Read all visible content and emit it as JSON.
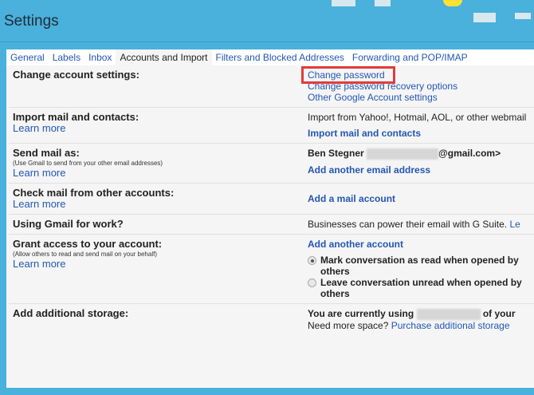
{
  "header": {
    "title": "Settings"
  },
  "tabs": [
    {
      "label": "General"
    },
    {
      "label": "Labels"
    },
    {
      "label": "Inbox"
    },
    {
      "label": "Accounts and Import"
    },
    {
      "label": "Filters and Blocked Addresses"
    },
    {
      "label": "Forwarding and POP/IMAP"
    }
  ],
  "rows": {
    "change": {
      "label": "Change account settings:",
      "links": [
        "Change password",
        "Change password recovery options",
        "Other Google Account settings"
      ]
    },
    "import": {
      "label": "Import mail and contacts:",
      "learn": "Learn more",
      "text": "Import from Yahoo!, Hotmail, AOL, or other webmail",
      "link": "Import mail and contacts"
    },
    "send": {
      "label": "Send mail as:",
      "sub": "(Use Gmail to send from your other email addresses)",
      "learn": "Learn more",
      "name": "Ben Stegner",
      "email_suffix": "@gmail.com>",
      "link": "Add another email address"
    },
    "check": {
      "label": "Check mail from other accounts:",
      "learn": "Learn more",
      "link": "Add a mail account"
    },
    "work": {
      "label": "Using Gmail for work?",
      "text": "Businesses can power their email with G Suite.",
      "link": "Le"
    },
    "grant": {
      "label": "Grant access to your account:",
      "sub": "(Allow others to read and send mail on your behalf)",
      "learn": "Learn more",
      "link": "Add another account",
      "radio1": "Mark conversation as read when opened by others",
      "radio2": "Leave conversation unread when opened by others"
    },
    "storage": {
      "label": "Add additional storage:",
      "text1": "You are currently using",
      "text2": "of your",
      "text3": "Need more space?",
      "link": "Purchase additional storage"
    }
  }
}
